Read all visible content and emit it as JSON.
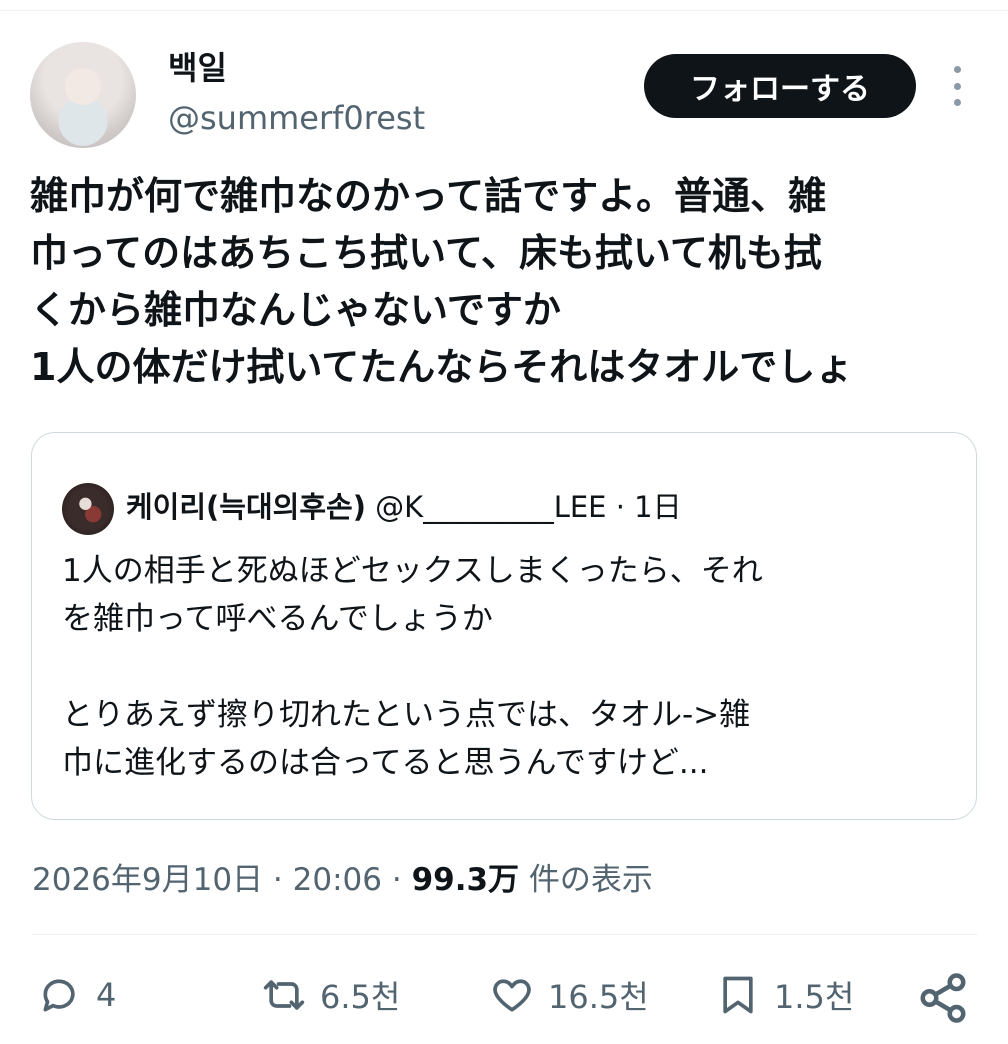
{
  "author": {
    "display_name": "백일",
    "handle": "@summerf0rest",
    "follow_label": "フォローする"
  },
  "tweet": {
    "lines": [
      "雑巾が何で雑巾なのかって話ですよ。普通、雑",
      "巾ってのはあちこち拭いて、床も拭いて机も拭",
      "くから雑巾なんじゃないですか",
      "1人の体だけ拭いてたんならそれはタオルでしょ"
    ]
  },
  "quoted": {
    "name": "케이리(늑대의후손)",
    "handle": "@K_________LEE",
    "separator": "·",
    "time": "1日",
    "lines": [
      "1人の相手と死ぬほどセックスしまくったら、それ",
      "を雑巾って呼べるんでしょうか",
      "",
      "とりあえず擦り切れたという点では、タオル->雑",
      "巾に進化するのは合ってると思うんですけど..."
    ]
  },
  "meta": {
    "date": "2026年9月10日",
    "sep1": "·",
    "time": "20:06",
    "sep2": "·",
    "views": "99.3万",
    "views_label": "件の表示"
  },
  "actions": {
    "reply_count": "4",
    "retweet_count": "6.5천",
    "like_count": "16.5천",
    "bookmark_count": "1.5천",
    "icons": [
      "reply-icon",
      "retweet-icon",
      "like-icon",
      "bookmark-icon",
      "share-icon"
    ],
    "icon_color": "#536471"
  },
  "colors": {
    "text": "#0f1419",
    "secondary": "#536471",
    "follow_bg": "#0f1419",
    "border": "#cfd9de"
  }
}
